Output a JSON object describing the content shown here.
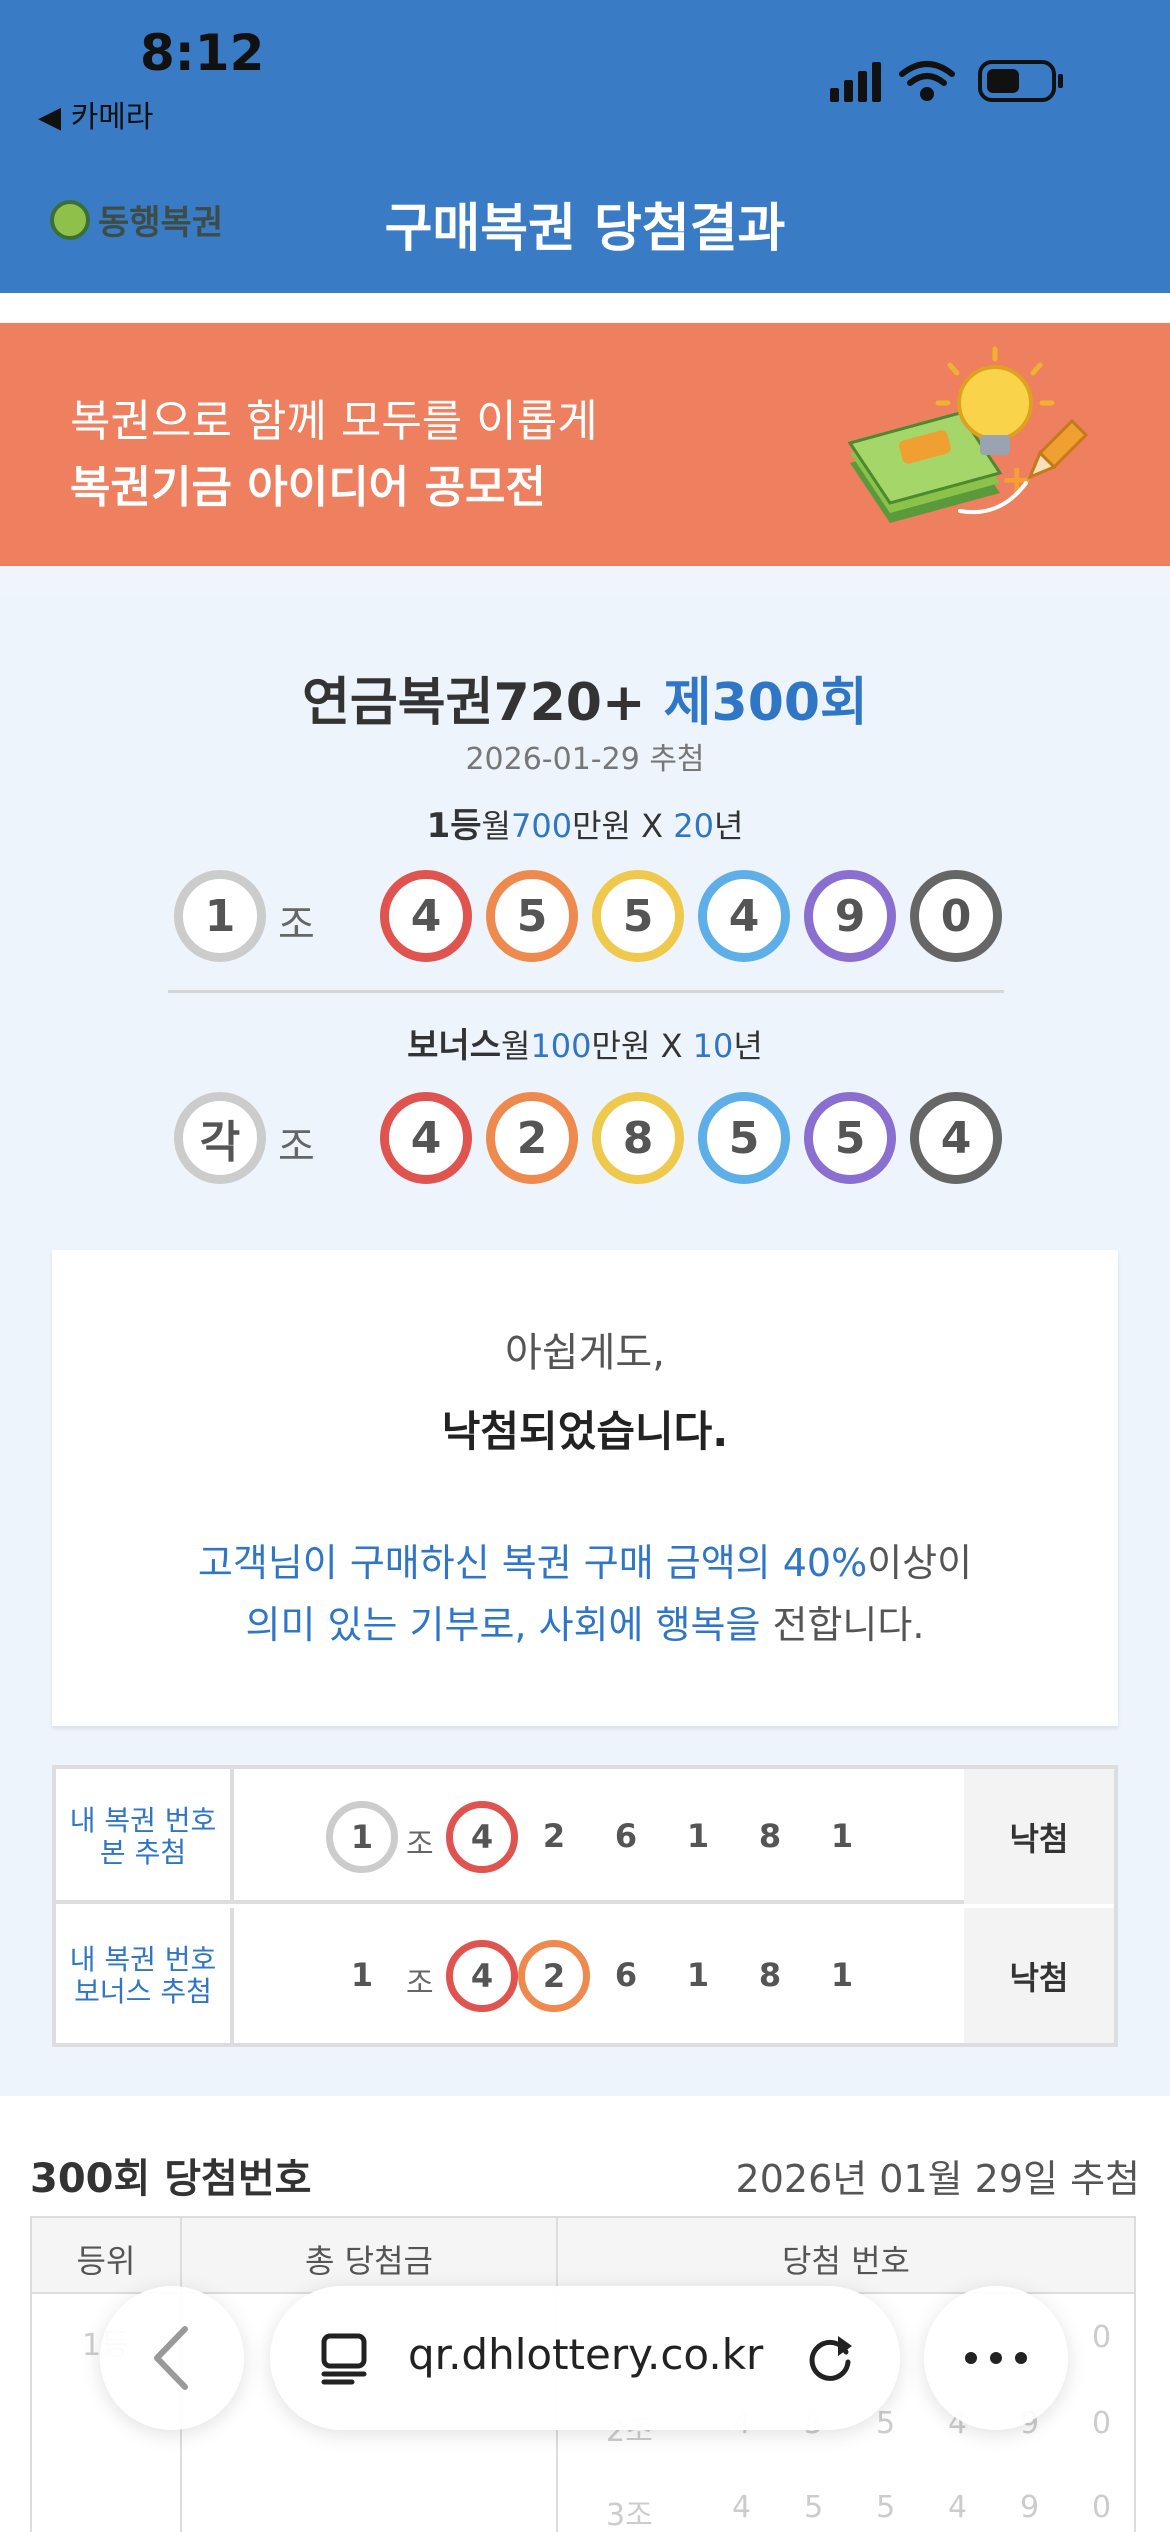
{
  "status_bar": {
    "time": "8:12",
    "back_app": "◀ 카메라"
  },
  "header": {
    "logo": "동행복권",
    "title": "구매복권 당첨결과"
  },
  "banner": {
    "line1": "복권으로 함께 모두를 이롭게",
    "line2": "복권기금 아이디어 공모전"
  },
  "result": {
    "game": "연금복권720+",
    "round": "제300회",
    "draw_date": "2026-01-29 추첨",
    "first_prize": {
      "rank": "1등",
      "pre": "월",
      "amount": "700",
      "unit": "만원 X ",
      "years": "20",
      "year_unit": "년"
    },
    "first_group": "1",
    "first_numbers": [
      "4",
      "5",
      "5",
      "4",
      "9",
      "0"
    ],
    "bonus_prize": {
      "rank": "보너스",
      "pre": "월",
      "amount": "100",
      "unit": "만원 X ",
      "years": "10",
      "year_unit": "년"
    },
    "bonus_group": "각",
    "bonus_numbers": [
      "4",
      "2",
      "8",
      "5",
      "5",
      "4"
    ],
    "jo_label": "조"
  },
  "message": {
    "line1": "아쉽게도,",
    "line2": "낙첨되었습니다.",
    "line3_blue": "고객님이 구매하신 복권 구매 금액의 40%",
    "line3_gray": "이상이",
    "line4_blue": "의미 있는 기부로, 사회에 행복을",
    "line4_gray": " 전합니다."
  },
  "my_tickets": [
    {
      "label1": "내 복권 번호",
      "label2": "본 추첨",
      "group": "1",
      "jo": "조",
      "digits": [
        "4",
        "2",
        "6",
        "1",
        "8",
        "1"
      ],
      "result": "낙첨"
    },
    {
      "label1": "내 복권 번호",
      "label2": "보너스 추첨",
      "group": "1",
      "jo": "조",
      "digits": [
        "4",
        "2",
        "6",
        "1",
        "8",
        "1"
      ],
      "result": "낙첨"
    }
  ],
  "winning": {
    "title": "300회 당첨번호",
    "date": "2026년 01월 29일 추첨",
    "headers": [
      "등위",
      "총 당첨금",
      "당첨 번호"
    ],
    "rows_visible": [
      "1등",
      "2조",
      "3조"
    ],
    "row_digits": [
      [
        "4",
        "5",
        "5",
        "4",
        "9",
        "0"
      ],
      [
        "4",
        "5",
        "5",
        "4",
        "9",
        "0"
      ],
      [
        "4",
        "5",
        "5",
        "4",
        "9",
        "0"
      ]
    ]
  },
  "browser": {
    "url": "qr.dhlottery.co.kr"
  },
  "colors": {
    "header_blue": "#3a7bc6",
    "banner": "#ee7f5f",
    "accent_blue": "#2f77c6",
    "ball_red": "#e05450",
    "ball_orange": "#ee8a4d",
    "ball_yellow": "#efc94c",
    "ball_blue": "#5eaee8",
    "ball_purple": "#8a6fd1",
    "ball_gray": "#666666"
  }
}
